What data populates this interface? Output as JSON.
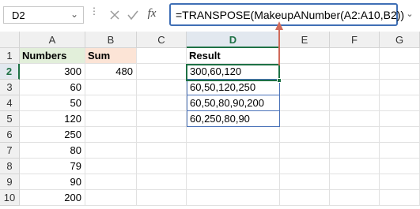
{
  "name_box": {
    "value": "D2"
  },
  "formula_bar": {
    "formula": "=TRANSPOSE(MakeupANumber(A2:A10,B2))"
  },
  "columns": [
    "A",
    "B",
    "C",
    "D",
    "E",
    "F",
    "G"
  ],
  "rows": [
    "1",
    "2",
    "3",
    "4",
    "5",
    "6",
    "7",
    "8",
    "9",
    "10"
  ],
  "headers": {
    "numbers": "Numbers",
    "sum": "Sum",
    "result": "Result"
  },
  "numbers": [
    "300",
    "60",
    "50",
    "120",
    "250",
    "80",
    "79",
    "90",
    "200"
  ],
  "sum_value": "480",
  "results": [
    "300,60,120",
    "60,50,120,250",
    "60,50,80,90,200",
    "60,250,80,90"
  ],
  "colors": {
    "selection": "#1e7145",
    "formula_border": "#3f6fb5",
    "arrow": "#d06a5a",
    "numbers_fill": "#e2efda",
    "sum_fill": "#fce4d6"
  },
  "icons": [
    "chevron-down-icon",
    "cancel-x-icon",
    "enter-check-icon",
    "fx-icon",
    "expand-chevron-icon",
    "arrow-up-annotation"
  ]
}
